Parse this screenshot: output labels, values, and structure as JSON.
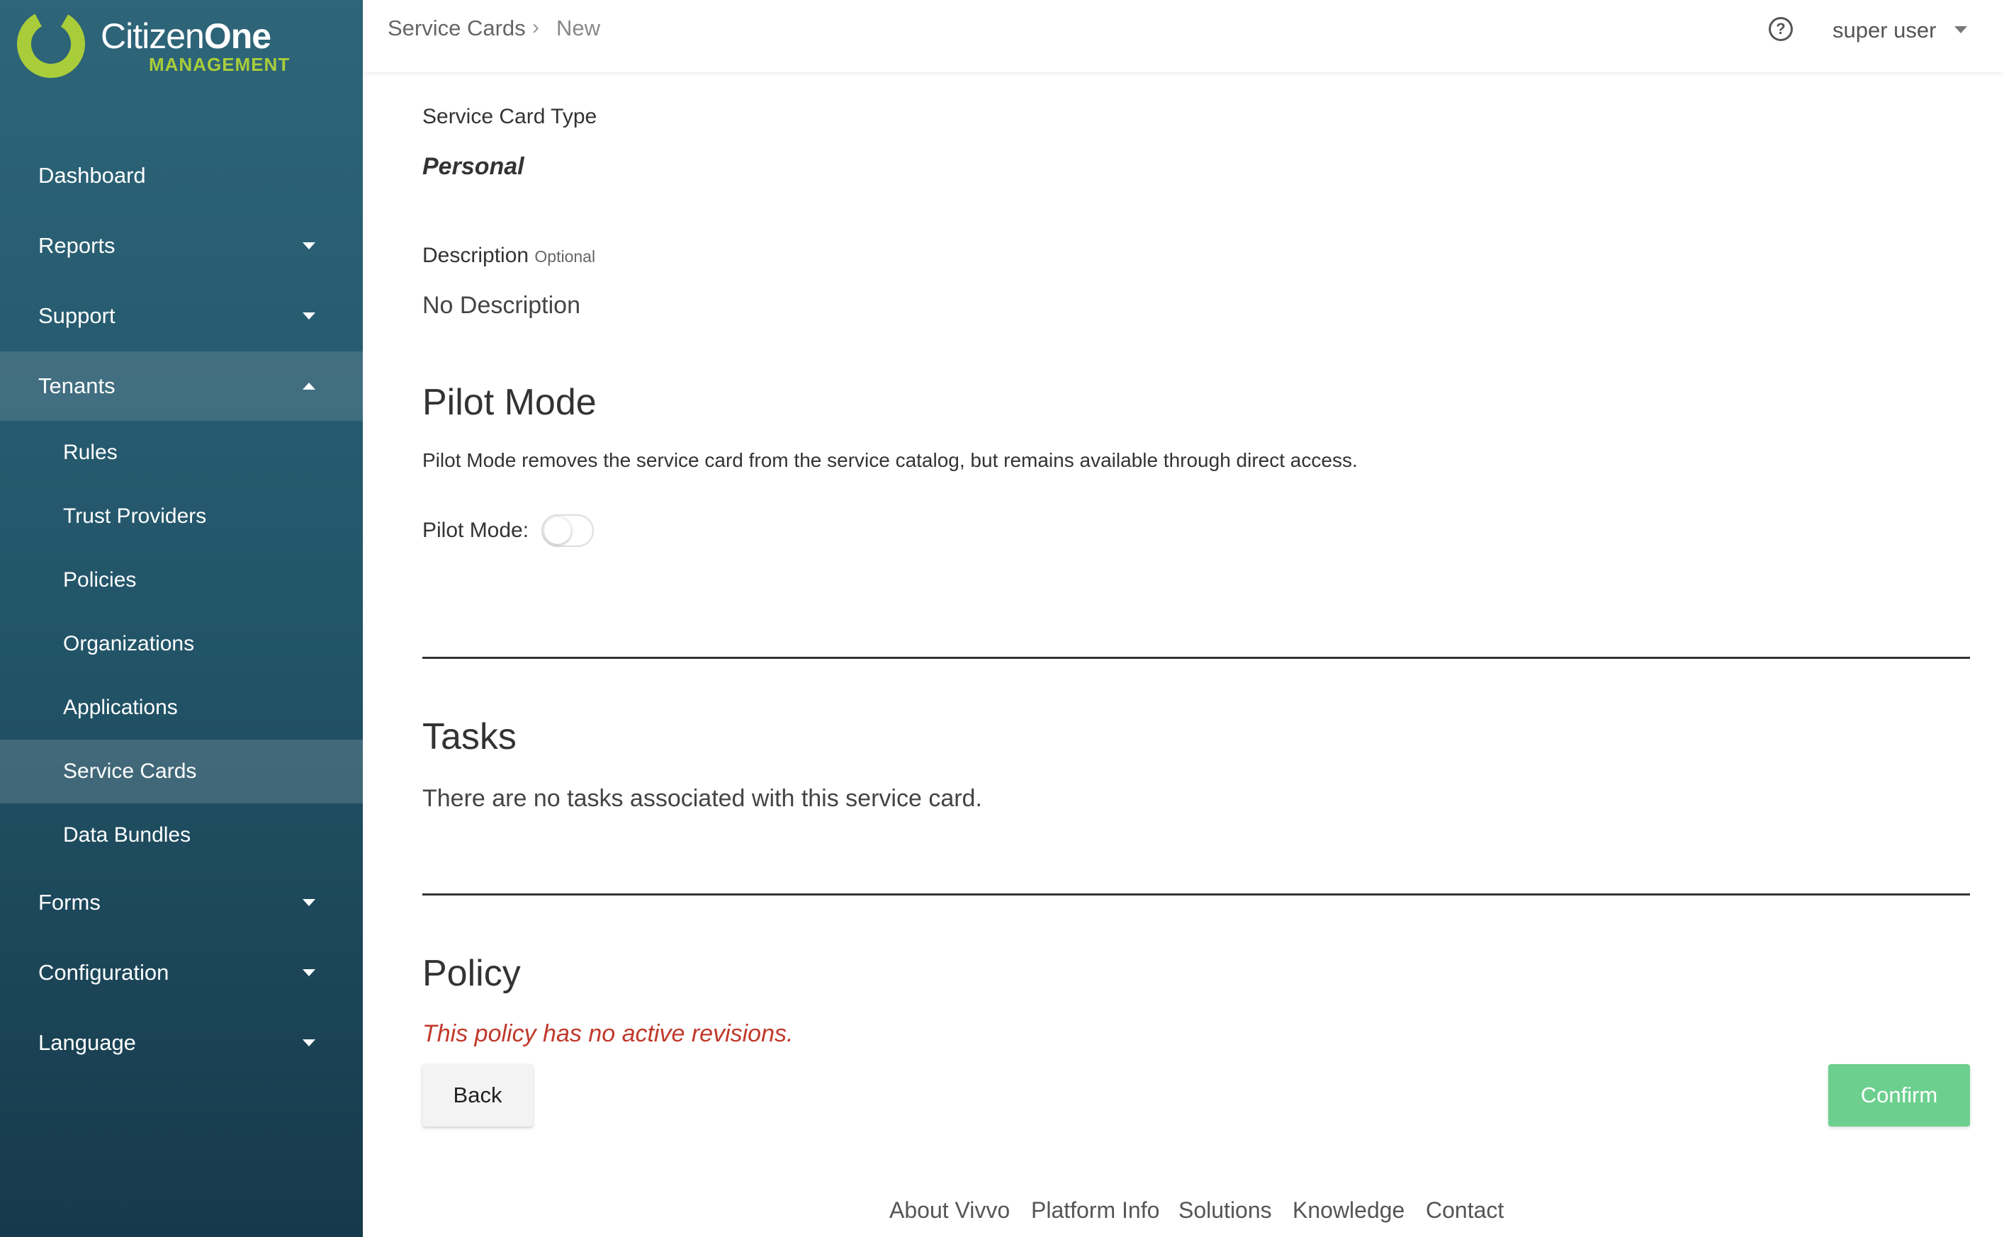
{
  "brand": {
    "name_light": "Citizen",
    "name_bold": "One",
    "subtitle": "MANAGEMENT",
    "accent_color": "#a9cd3a"
  },
  "sidebar": {
    "items": [
      {
        "label": "Dashboard",
        "caret": "none"
      },
      {
        "label": "Reports",
        "caret": "chevron-down-icon"
      },
      {
        "label": "Support",
        "caret": "chevron-down-icon"
      },
      {
        "label": "Tenants",
        "caret": "chevron-up-icon",
        "expanded": true
      },
      {
        "label": "Forms",
        "caret": "chevron-down-icon"
      },
      {
        "label": "Configuration",
        "caret": "chevron-down-icon"
      },
      {
        "label": "Language",
        "caret": "chevron-down-icon"
      }
    ],
    "tenants_children": [
      {
        "label": "Rules"
      },
      {
        "label": "Trust Providers"
      },
      {
        "label": "Policies"
      },
      {
        "label": "Organizations"
      },
      {
        "label": "Applications"
      },
      {
        "label": "Service Cards",
        "active": true
      },
      {
        "label": "Data Bundles"
      }
    ]
  },
  "header": {
    "breadcrumb": [
      "Service Cards",
      "New"
    ],
    "help_icon": "question-circle-icon",
    "user_name": "super user"
  },
  "main": {
    "type_label": "Service Card Type",
    "type_value": "Personal",
    "description_label": "Description",
    "description_optional": "Optional",
    "description_value": "No Description",
    "pilot": {
      "title": "Pilot Mode",
      "text": "Pilot Mode removes the service card from the service catalog, but remains available through direct access.",
      "toggle_label": "Pilot Mode:",
      "toggle_on": false
    },
    "tasks": {
      "title": "Tasks",
      "text": "There are no tasks associated with this service card."
    },
    "policy": {
      "title": "Policy",
      "error": "This policy has no active revisions.",
      "error_color": "#c0392b"
    },
    "back_label": "Back",
    "confirm_label": "Confirm",
    "confirm_color": "#6ccf8e"
  },
  "footer": {
    "links": [
      "About Vivvo",
      "Platform Info",
      "Solutions",
      "Knowledge",
      "Contact"
    ]
  }
}
